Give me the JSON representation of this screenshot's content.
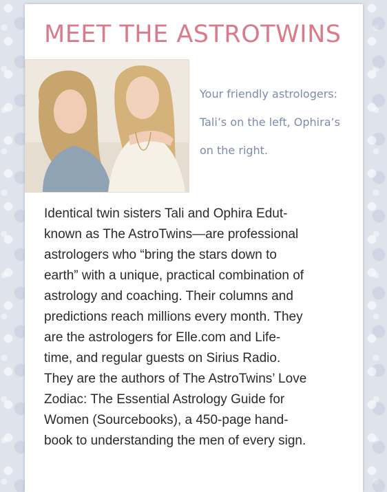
{
  "title": "MEET THE ASTROTWINS",
  "photo": {
    "alt": "Tali and Ophira Edut"
  },
  "caption": {
    "lines": [
      "Your friendly astrologers:",
      "Tali’s on the left, Ophira’s",
      "on the right."
    ]
  },
  "bio": {
    "lines": [
      "Identical twin sisters Tali and Ophira Edut-",
      "known as The AstroTwins—are professional",
      "astrologers who “bring the stars down to",
      "earth” with a unique, practical combination of",
      "astrology and coaching. Their columns and",
      "predictions reach millions every month. They",
      "are the astrologers for Elle.com  and Life-",
      "time, and regular guests on Sirius Radio.",
      "They are the authors of The AstroTwins’ Love",
      "Zodiac: The Essential Astrology Guide for",
      "Women (Sourcebooks), a 450-page hand-",
      "book to understanding the men of every sign."
    ]
  },
  "colors": {
    "title": "#d97b8a",
    "caption": "#7e8aae",
    "body_text": "#2a2a2a",
    "card": "#ffffff",
    "background": "#dfe4ec"
  }
}
